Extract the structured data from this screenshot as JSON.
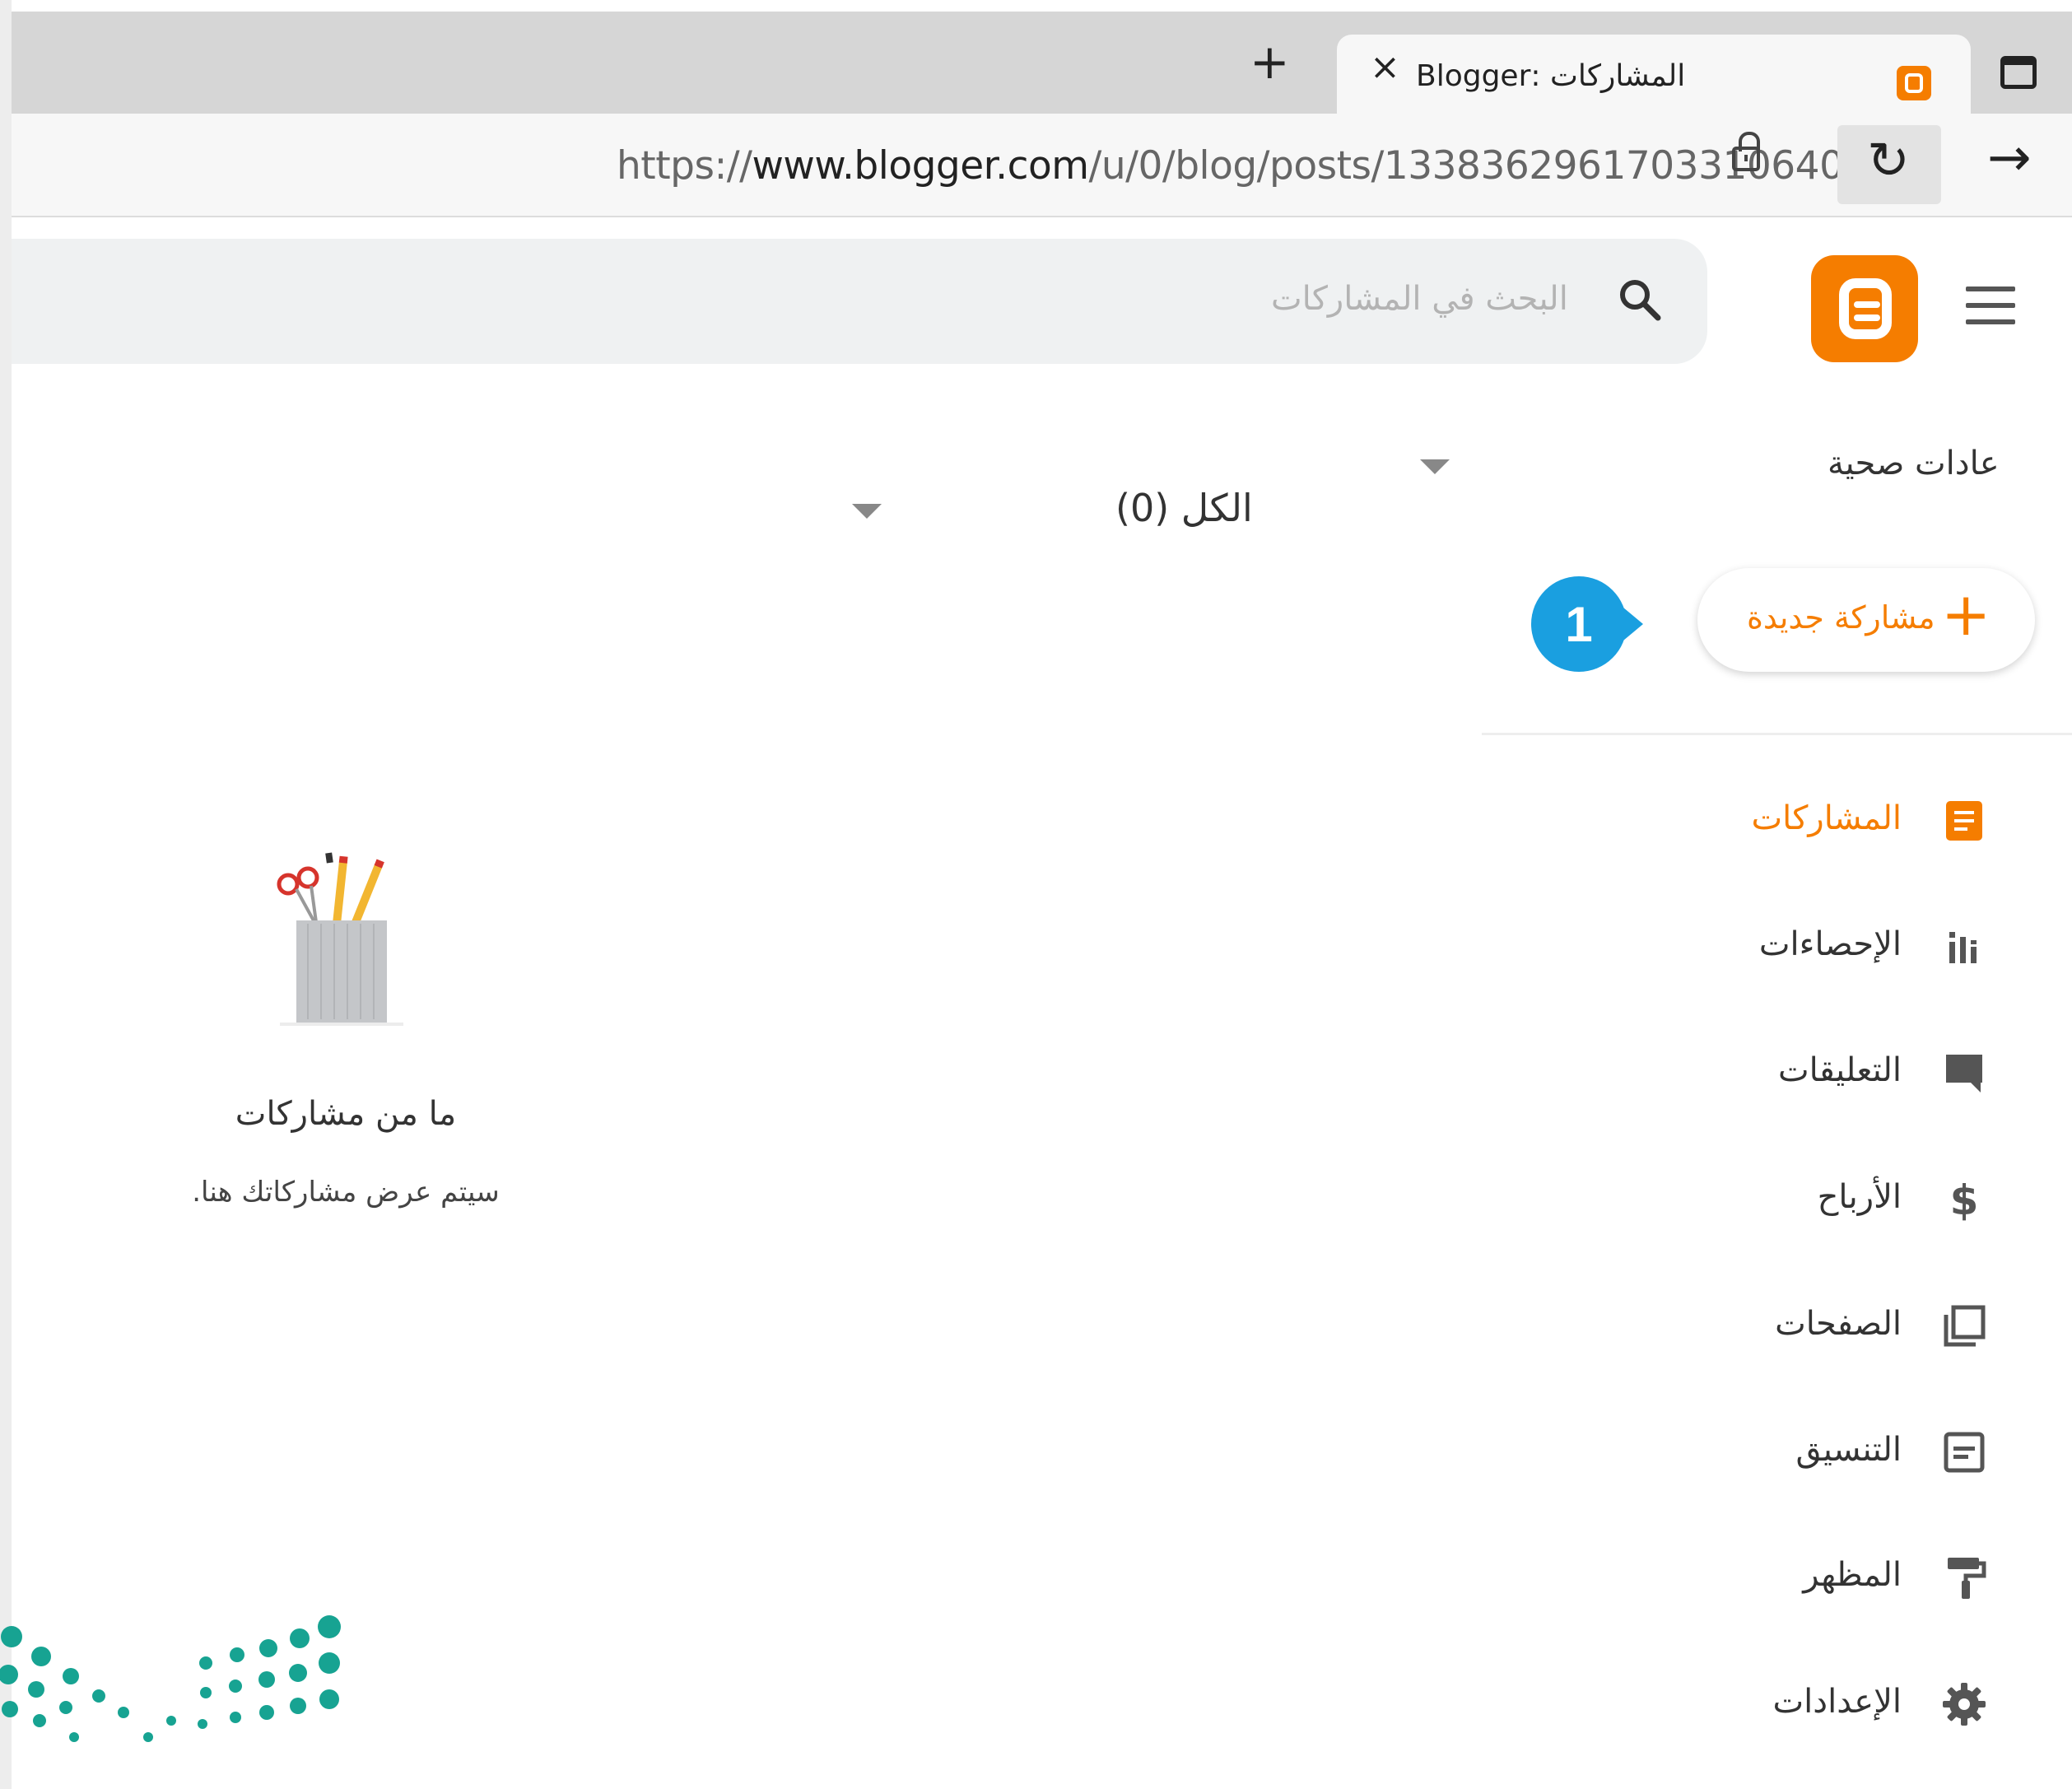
{
  "browser": {
    "tab_title": "المشاركات :Blogger",
    "new_tab_symbol": "+",
    "close_symbol": "×",
    "url_prefix": "https://",
    "url_host": "www.blogger.com",
    "url_path": "/u/0/blog/posts/1338362961703310640",
    "reload_symbol": "↻",
    "forward_symbol": "→"
  },
  "header": {
    "search_placeholder": "البحث في المشاركات"
  },
  "sidebar": {
    "blog_name": "عادات صحية",
    "new_post_label": "مشاركة جديدة",
    "new_post_plus": "+",
    "callout_number": "1",
    "items": [
      {
        "label": "المشاركات",
        "icon": "posts-icon",
        "active": true
      },
      {
        "label": "الإحصاءات",
        "icon": "stats-icon",
        "active": false
      },
      {
        "label": "التعليقات",
        "icon": "comments-icon",
        "active": false
      },
      {
        "label": "الأرباح",
        "icon": "earnings-icon",
        "active": false
      },
      {
        "label": "الصفحات",
        "icon": "pages-icon",
        "active": false
      },
      {
        "label": "التنسيق",
        "icon": "layout-icon",
        "active": false
      },
      {
        "label": "المظهر",
        "icon": "theme-icon",
        "active": false
      },
      {
        "label": "الإعدادات",
        "icon": "settings-icon",
        "active": false
      }
    ]
  },
  "main": {
    "filter_label": "الكل (0)",
    "empty_title": "ما من مشاركات",
    "empty_subtitle": "سيتم عرض مشاركاتك هنا."
  },
  "colors": {
    "accent": "#f57d00",
    "callout": "#1a9fe0",
    "watermark": "#17a392"
  }
}
